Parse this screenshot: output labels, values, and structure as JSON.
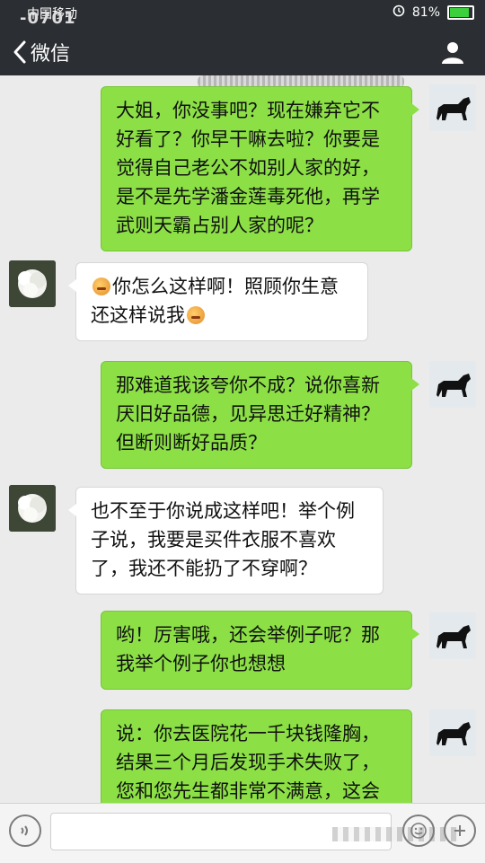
{
  "status_bar": {
    "carrier": "中国移动",
    "watermark": "-0701",
    "battery": "81%",
    "battery_level": 0.81
  },
  "header": {
    "back_label": "微信"
  },
  "messages": [
    {
      "side": "me",
      "avatar": "dog-avatar",
      "text": "大姐，你没事吧？现在嫌弃它不好看了？你早干嘛去啦？你要是觉得自己老公不如别人家的好，是不是先学潘金莲毒死他，再学武则天霸占别人家的呢？"
    },
    {
      "side": "other",
      "avatar": "flower-avatar",
      "text_before_emoji": "",
      "text": "你怎么这样啊！照顾你生意还这样说我"
    },
    {
      "side": "me",
      "avatar": "dog-avatar",
      "text": "那难道我该夸你不成？说你喜新厌旧好品德，见异思迁好精神？但断则断好品质？"
    },
    {
      "side": "other",
      "avatar": "flower-avatar",
      "text": "也不至于你说成这样吧！举个例子说，我要是买件衣服不喜欢了，我还不能扔了不穿啊？"
    },
    {
      "side": "me",
      "avatar": "dog-avatar",
      "text": "哟！厉害哦，还会举例子呢？那我举个例子你也想想"
    },
    {
      "side": "me",
      "avatar": "dog-avatar",
      "text": "说：你去医院花一千块钱隆胸，结果三个月后发现手术失败了，您和您先生都非常不满意，这会你会毅"
    }
  ],
  "colors": {
    "my_bubble": "#8ce046",
    "other_bubble": "#ffffff",
    "header_bg": "#2b2f33",
    "chat_bg": "#ebebeb"
  }
}
